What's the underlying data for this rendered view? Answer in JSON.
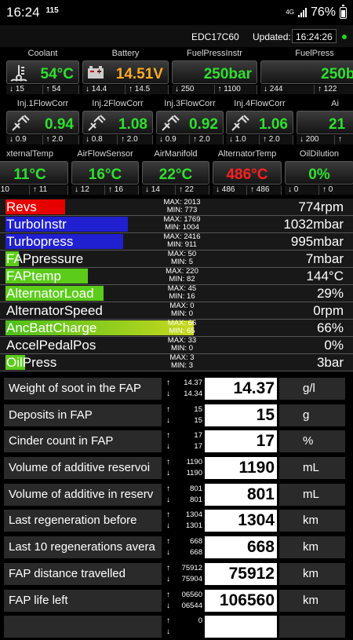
{
  "status_bar": {
    "time": "16:24",
    "notif": "115",
    "network": "4G",
    "battery": "76%"
  },
  "header": {
    "ecu": "EDC17C60",
    "updated_label": "Updated:",
    "updated_time": "16:24:26"
  },
  "colors": {
    "revs": "#e60000",
    "turbo": "#2020d0",
    "green": "#5ccc1a",
    "anc_batt": "#b8d820",
    "value_green": "#2fe02f",
    "value_orange": "#ffaa20",
    "value_red": "#ff2020"
  },
  "gauges_row1": [
    {
      "label": "Coolant",
      "value": "54°C",
      "min": "15",
      "max": "54",
      "icon": "coolant-thermometer-icon"
    },
    {
      "label": "Battery",
      "value": "14.51V",
      "min": "14.4",
      "max": "14.5",
      "icon": "battery-icon"
    },
    {
      "label": "FuelPressInstr",
      "value": "250bar",
      "min": "250",
      "max": "1100"
    },
    {
      "label": "FuelPress",
      "value": "250ba",
      "min": "244",
      "max": "122"
    }
  ],
  "gauges_row2": [
    {
      "label": "Inj.1FlowCorr",
      "value": "0.94",
      "min": "0.9",
      "max": "2.0",
      "icon": "injector-icon"
    },
    {
      "label": "Inj.2FlowCorr",
      "value": "1.08",
      "min": "0.8",
      "max": "2.0",
      "icon": "injector-icon"
    },
    {
      "label": "Inj.3FlowCorr",
      "value": "0.92",
      "min": "0.9",
      "max": "2.0",
      "icon": "injector-icon"
    },
    {
      "label": "Inj.4FlowCorr",
      "value": "1.06",
      "min": "1.0",
      "max": "2.0",
      "icon": "injector-icon"
    },
    {
      "label": "Ai",
      "value": "21",
      "min": "200",
      "max": ""
    }
  ],
  "gauges_row3": [
    {
      "label": "xternalTemp",
      "value": "11°C",
      "min": "10",
      "max": "11"
    },
    {
      "label": "AirFlowSensor",
      "value": "16°C",
      "min": "12",
      "max": "16"
    },
    {
      "label": "AirManifold",
      "value": "22°C",
      "min": "14",
      "max": "22"
    },
    {
      "label": "AlternatorTemp",
      "value": "486°C",
      "min": "486",
      "max": "486"
    },
    {
      "label": "OilDilution",
      "value": "0%",
      "min": "0",
      "max": "0"
    }
  ],
  "bars": [
    {
      "label": "Revs",
      "max": "MAX: 2013",
      "min": "MIN: 773",
      "value": "774rpm",
      "fill": 0.4,
      "color": "#e60000"
    },
    {
      "label": "TurboInstr",
      "max": "MAX: 1769",
      "min": "MIN: 1004",
      "value": "1032mbar",
      "fill": 0.82,
      "color": "#2020d0"
    },
    {
      "label": "Turbopress",
      "max": "MAX: 2416",
      "min": "MIN: 911",
      "value": "995mbar",
      "fill": 0.79,
      "color": "#2020d0"
    },
    {
      "label": "FAPpressure",
      "max": "MAX: 50",
      "min": "MIN: 5",
      "value": "7mbar",
      "fill": 0.09,
      "color": "#5ccc1a"
    },
    {
      "label": "FAPtemp",
      "max": "MAX: 220",
      "min": "MIN: 82",
      "value": "144°C",
      "fill": 0.55,
      "color": "#5ccc1a"
    },
    {
      "label": "AlternatorLoad",
      "max": "MAX: 45",
      "min": "MIN: 16",
      "value": "29%",
      "fill": 0.66,
      "color": "#5ccc1a"
    },
    {
      "label": "AlternatorSpeed",
      "max": "MAX: 0",
      "min": "MIN: 0",
      "value": "0rpm",
      "fill": 0,
      "color": "#5ccc1a"
    },
    {
      "label": "AncBattCharge",
      "max": "MAX: 66",
      "min": "MIN: 65",
      "value": "66%",
      "fill": 1.0,
      "color": "#b8d820"
    },
    {
      "label": "AccelPedalPos",
      "max": "MAX: 33",
      "min": "MIN: 0",
      "value": "0%",
      "fill": 0,
      "color": "#5ccc1a"
    },
    {
      "label": "OilPress",
      "max": "MAX: 3",
      "min": "MIN: 3",
      "value": "3bar",
      "fill": 0.13,
      "color": "#5ccc1a"
    }
  ],
  "table": [
    {
      "label": "Weight of soot in the FAP",
      "max": "14.37",
      "min": "14.34",
      "value": "14.37",
      "unit": "g/l"
    },
    {
      "label": "Deposits in FAP",
      "max": "15",
      "min": "15",
      "value": "15",
      "unit": "g"
    },
    {
      "label": "Cinder count in FAP",
      "max": "17",
      "min": "17",
      "value": "17",
      "unit": "%"
    },
    {
      "label": "Volume of additive reservoi",
      "max": "1190",
      "min": "1190",
      "value": "1190",
      "unit": "mL"
    },
    {
      "label": "Volume of additive in reserv",
      "max": "801",
      "min": "801",
      "value": "801",
      "unit": "mL"
    },
    {
      "label": "Last regeneration before",
      "max": "1304",
      "min": "1301",
      "value": "1304",
      "unit": "km"
    },
    {
      "label": "Last 10 regenerations avera",
      "max": "668",
      "min": "668",
      "value": "668",
      "unit": "km"
    },
    {
      "label": "FAP distance travelled",
      "max": "75912",
      "min": "75904",
      "value": "75912",
      "unit": "km"
    },
    {
      "label": "FAP life left",
      "max": "06560",
      "min": "06544",
      "value": "106560",
      "unit": "km"
    },
    {
      "label": "",
      "max": "0",
      "min": "",
      "value": "",
      "unit": ""
    }
  ]
}
